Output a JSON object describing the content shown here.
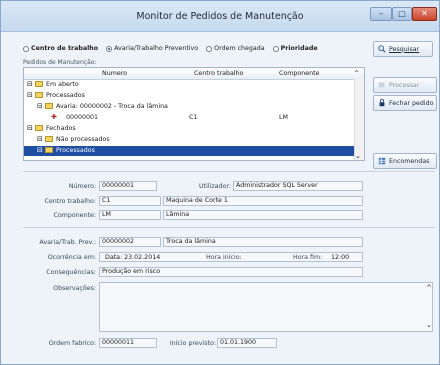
{
  "window": {
    "title": "Monitor de Pedidos de Manutenção"
  },
  "radio": [
    {
      "label": "Centro de trabalho",
      "selected": false,
      "bold": true
    },
    {
      "label": "Avaria/Trabalho Preventivo",
      "selected": true,
      "bold": false
    },
    {
      "label": "Ordem chegada",
      "selected": false,
      "bold": false
    },
    {
      "label": "Prioridade",
      "selected": false,
      "bold": true
    }
  ],
  "buttons": {
    "pesquisar": "Pesquisar",
    "processar": "Processar",
    "fechar": "Fechar pedido",
    "encomendas": "Encomendas"
  },
  "pedidos_label": "Pedidos de Manutenção:",
  "tree": {
    "headers": {
      "numero": "Numero",
      "centro": "Centro trabalho",
      "componente": "Componente"
    },
    "rows": [
      {
        "text": "Em aberto",
        "indent": 0,
        "folder": true
      },
      {
        "text": "Processados",
        "indent": 0,
        "folder": true
      },
      {
        "text": "Avaria: 00000002 - Troca da lâmina",
        "indent": 1,
        "folder": true
      },
      {
        "text": "00000001",
        "indent": 2,
        "folder": false,
        "centro": "C1",
        "componente": "LM"
      },
      {
        "text": "Fechados",
        "indent": 0,
        "folder": true
      },
      {
        "text": "Não processados",
        "indent": 1,
        "folder": true
      },
      {
        "text": "Processados",
        "indent": 1,
        "folder": true,
        "selected": true
      }
    ]
  },
  "form": {
    "numero_label": "Número:",
    "numero": "00000001",
    "utilizador_label": "Utilizador:",
    "utilizador": "Administrador SQL Server",
    "centro_label": "Centro trabalho:",
    "centro_code": "C1",
    "centro_name": "Maquina de Corte 1",
    "componente_label": "Componente:",
    "componente_code": "LM",
    "componente_name": "Lâmina",
    "avaria_label": "Avaria/Trab. Prev.:",
    "avaria_code": "00000002",
    "avaria_name": "Troca da lâmina",
    "ocorrencia_label": "Ocorrência em:",
    "data": "Data: 23.02.2014",
    "hora_inicio_label": "Hora início:",
    "hora_fim_label": "Hora fim:",
    "hora_fim": "12:00",
    "consequencias_label": "Consequências:",
    "consequencias": "Produção em risco",
    "observacoes_label": "Observações:",
    "ordem_label": "Ordem fabrico:",
    "ordem": "00000011",
    "inicio_label": "Início previsto:",
    "inicio": "01.01.1900"
  }
}
